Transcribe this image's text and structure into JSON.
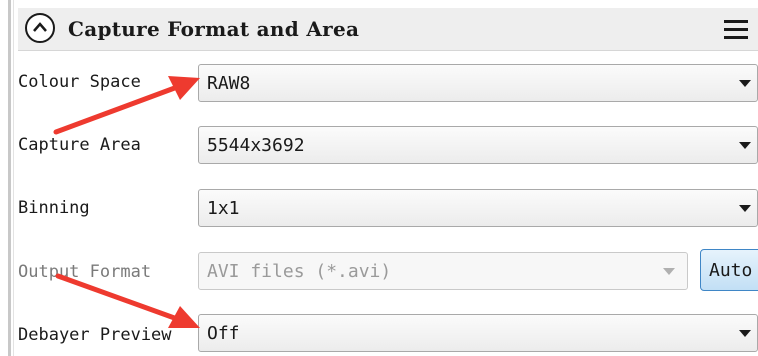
{
  "panel": {
    "title": "Capture Format and Area",
    "collapse_icon": "chevron-up-circle-icon",
    "menu_icon": "hamburger-menu-icon"
  },
  "rows": [
    {
      "label": "Colour Space",
      "value": "RAW8"
    },
    {
      "label": "Capture Area",
      "value": "5544x3692"
    },
    {
      "label": "Binning",
      "value": "1x1"
    },
    {
      "label": "Output Format",
      "value": "AVI files (*.avi)",
      "disabled": true
    },
    {
      "label": "Debayer Preview",
      "value": "Off"
    }
  ],
  "auto_button": {
    "label": "Auto"
  },
  "colors": {
    "annotation_arrow": "#ee3a2f",
    "button_border": "#3f86c6"
  }
}
